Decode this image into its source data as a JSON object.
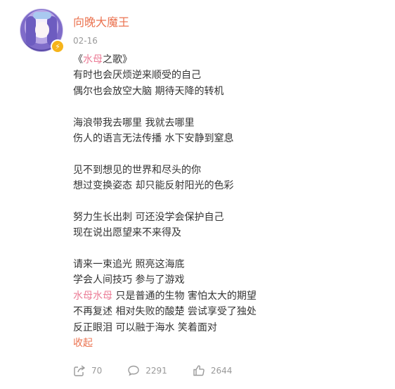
{
  "user": {
    "name": "向晚大魔王",
    "date": "02-16",
    "verified_icon": "lightning-badge-icon",
    "avatar_icon": "anime-avatar"
  },
  "post": {
    "lines": [
      [
        {
          "t": "《"
        },
        {
          "t": "水母",
          "pink": true
        },
        {
          "t": "之歌》"
        }
      ],
      [
        {
          "t": "有时也会厌烦逆来顺受的自己"
        }
      ],
      [
        {
          "t": "偶尔也会放空大脑 期待天降的转机"
        }
      ],
      [],
      [
        {
          "t": "海浪带我去哪里 我就去哪里"
        }
      ],
      [
        {
          "t": "伤人的语言无法传播 水下安静到窒息"
        }
      ],
      [],
      [
        {
          "t": "见不到想见的世界和尽头的你"
        }
      ],
      [
        {
          "t": "想过变换姿态 却只能反射阳光的色彩"
        }
      ],
      [],
      [
        {
          "t": "努力生长出刺 可还没学会保护自己"
        }
      ],
      [
        {
          "t": "现在说出愿望来不来得及"
        }
      ],
      [],
      [
        {
          "t": "请来一束追光 照亮这海底"
        }
      ],
      [
        {
          "t": "学会人间技巧 参与了游戏"
        }
      ],
      [
        {
          "t": "水母",
          "pink": true
        },
        {
          "t": "水母",
          "pink": true
        },
        {
          "t": " 只是普通的生物 害怕太大的期望"
        }
      ],
      [
        {
          "t": "不再复述 相对失败的酸楚 尝试享受了独处"
        }
      ],
      [
        {
          "t": "反正眼泪 可以融于海水  笑着面对"
        }
      ]
    ],
    "collapse_label": "收起"
  },
  "actions": {
    "share": {
      "icon": "share-icon",
      "count": "70"
    },
    "comment": {
      "icon": "comment-icon",
      "count": "2291"
    },
    "like": {
      "icon": "thumbs-up-icon",
      "count": "2644"
    }
  },
  "colors": {
    "username": "#eb7350",
    "highlight": "#eb7c96",
    "muted": "#999999",
    "text": "#333333"
  }
}
